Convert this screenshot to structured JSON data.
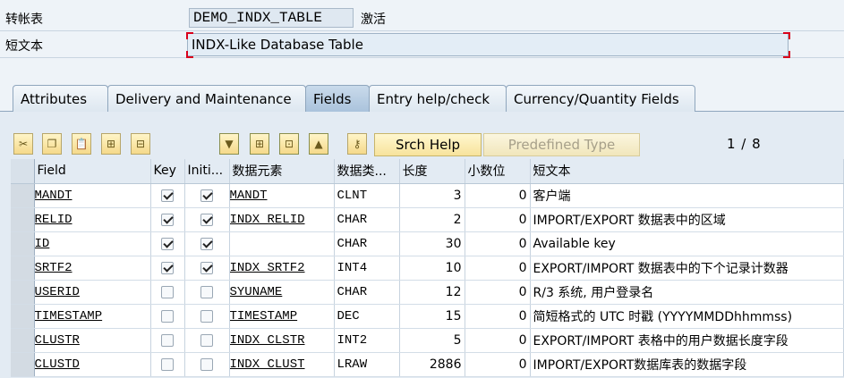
{
  "header": {
    "table_label": "转帐表",
    "table_name": "DEMO_INDX_TABLE",
    "status": "激活",
    "short_text_label": "短文本",
    "short_text": "INDX-Like Database Table"
  },
  "tabs": [
    {
      "label": "Attributes",
      "active": false
    },
    {
      "label": "Delivery and Maintenance",
      "active": false
    },
    {
      "label": "Fields",
      "active": true
    },
    {
      "label": "Entry help/check",
      "active": false
    },
    {
      "label": "Currency/Quantity Fields",
      "active": false
    }
  ],
  "toolbar": {
    "srch_help": "Srch Help",
    "predefined_type": "Predefined Type",
    "pager": "1 / 8",
    "icons": [
      "scissors-icon",
      "copy-icon",
      "paste-icon",
      "insert-row-icon",
      "delete-row-icon",
      "sort-down-icon",
      "expand-icon",
      "collapse-icon",
      "sort-up-icon",
      "key-icon"
    ]
  },
  "table": {
    "columns": [
      "Field",
      "Key",
      "Initi...",
      "数据元素",
      "数据类...",
      "长度",
      "小数位",
      "短文本"
    ],
    "rows": [
      {
        "field": "MANDT",
        "key": true,
        "init": true,
        "element": "MANDT",
        "type": "CLNT",
        "length": "3",
        "decimals": "0",
        "text": "客户端"
      },
      {
        "field": "RELID",
        "key": true,
        "init": true,
        "element": "INDX_RELID",
        "type": "CHAR",
        "length": "2",
        "decimals": "0",
        "text": "IMPORT/EXPORT 数据表中的区域"
      },
      {
        "field": "ID",
        "key": true,
        "init": true,
        "element": "",
        "type": "CHAR",
        "length": "30",
        "decimals": "0",
        "text": "Available key"
      },
      {
        "field": "SRTF2",
        "key": true,
        "init": true,
        "element": "INDX_SRTF2",
        "type": "INT4",
        "length": "10",
        "decimals": "0",
        "text": "EXPORT/IMPORT 数据表中的下个记录计数器"
      },
      {
        "field": "USERID",
        "key": false,
        "init": false,
        "element": "SYUNAME",
        "type": "CHAR",
        "length": "12",
        "decimals": "0",
        "text": "R/3 系统, 用户登录名"
      },
      {
        "field": "TIMESTAMP",
        "key": false,
        "init": false,
        "element": "TIMESTAMP",
        "type": "DEC",
        "length": "15",
        "decimals": "0",
        "text": "简短格式的 UTC 时戳 (YYYYMMDDhhmmss)"
      },
      {
        "field": "CLUSTR",
        "key": false,
        "init": false,
        "element": "INDX_CLSTR",
        "type": "INT2",
        "length": "5",
        "decimals": "0",
        "text": "EXPORT/IMPORT 表格中的用户数据长度字段"
      },
      {
        "field": "CLUSTD",
        "key": false,
        "init": false,
        "element": "INDX_CLUST",
        "type": "LRAW",
        "length": "2886",
        "decimals": "0",
        "text": "IMPORT/EXPORT数据库表的数据字段"
      }
    ]
  }
}
